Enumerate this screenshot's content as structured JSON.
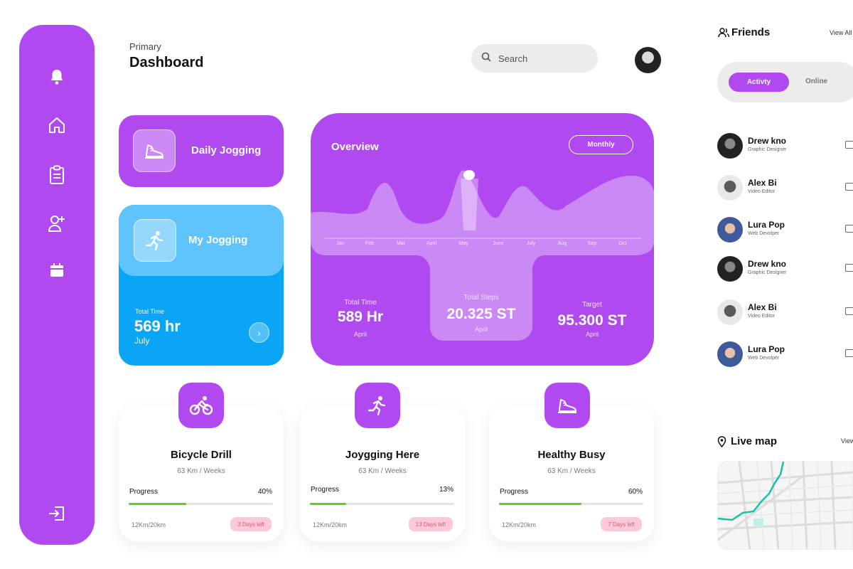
{
  "colors": {
    "accent": "#b04af0",
    "blue": "#0aa5f5",
    "progress": "#5ad11c",
    "badge": "#fbc9d7"
  },
  "sidebar": {
    "items": [
      {
        "icon": "bell-icon"
      },
      {
        "icon": "home-icon"
      },
      {
        "icon": "clipboard-icon"
      },
      {
        "icon": "add-user-icon"
      },
      {
        "icon": "calendar-icon"
      },
      {
        "icon": "logout-icon"
      }
    ]
  },
  "header": {
    "breadcrumb": "Primary",
    "title": "Dashboard",
    "search_placeholder": "Search"
  },
  "daily_card": {
    "label": "Daily Jogging"
  },
  "my_jogging": {
    "label": "My Jogging",
    "stat_label": "Total Time",
    "stat_value": "569 hr",
    "stat_month": "July"
  },
  "overview": {
    "title": "Overview",
    "period_button": "Monthly",
    "months": [
      "Jan",
      "Feb",
      "Mar",
      "April",
      "May",
      "June",
      "July",
      "Aug",
      "Sep",
      "Oct"
    ],
    "stats": [
      {
        "label": "Total Time",
        "value": "589 Hr",
        "sub": "April"
      },
      {
        "label": "Total Steps",
        "value": "20.325 ST",
        "sub": "April"
      },
      {
        "label": "Target",
        "value": "95.300 ST",
        "sub": "April"
      }
    ]
  },
  "activities": [
    {
      "title": "Bicycle Drill",
      "sub": "63 Km / Weeks",
      "progress_label": "Progress",
      "progress": "40%",
      "progress_value": 0.4,
      "distance": "12Km/20km",
      "badge": "3 Days left",
      "icon": "bicycle-icon"
    },
    {
      "title": "Joygging Here",
      "sub": "63 Km / Weeks",
      "progress_label": "Progress",
      "progress": "13%",
      "progress_value": 0.25,
      "distance": "12Km/20km",
      "badge": "13 Days left",
      "icon": "runner-icon"
    },
    {
      "title": "Healthy Busy",
      "sub": "63 Km / Weeks",
      "progress_label": "Progress",
      "progress": "60%",
      "progress_value": 0.57,
      "distance": "12Km/20km",
      "badge": "7 Days left",
      "icon": "shoe-icon"
    }
  ],
  "friends": {
    "title": "Friends",
    "view_all": "View All",
    "tabs": {
      "active": "Activty",
      "other": "Online"
    },
    "list": [
      {
        "name": "Drew kno",
        "role": "Graphic Designer"
      },
      {
        "name": "Alex Bi",
        "role": "Video Editor"
      },
      {
        "name": "Lura Pop",
        "role": "Web Devolper"
      },
      {
        "name": "Drew kno",
        "role": "Graphic Designer"
      },
      {
        "name": "Alex Bi",
        "role": "Video Editor"
      },
      {
        "name": "Lura Pop",
        "role": "Web Devolper"
      }
    ]
  },
  "live_map": {
    "title": "Live map",
    "view": "View"
  }
}
